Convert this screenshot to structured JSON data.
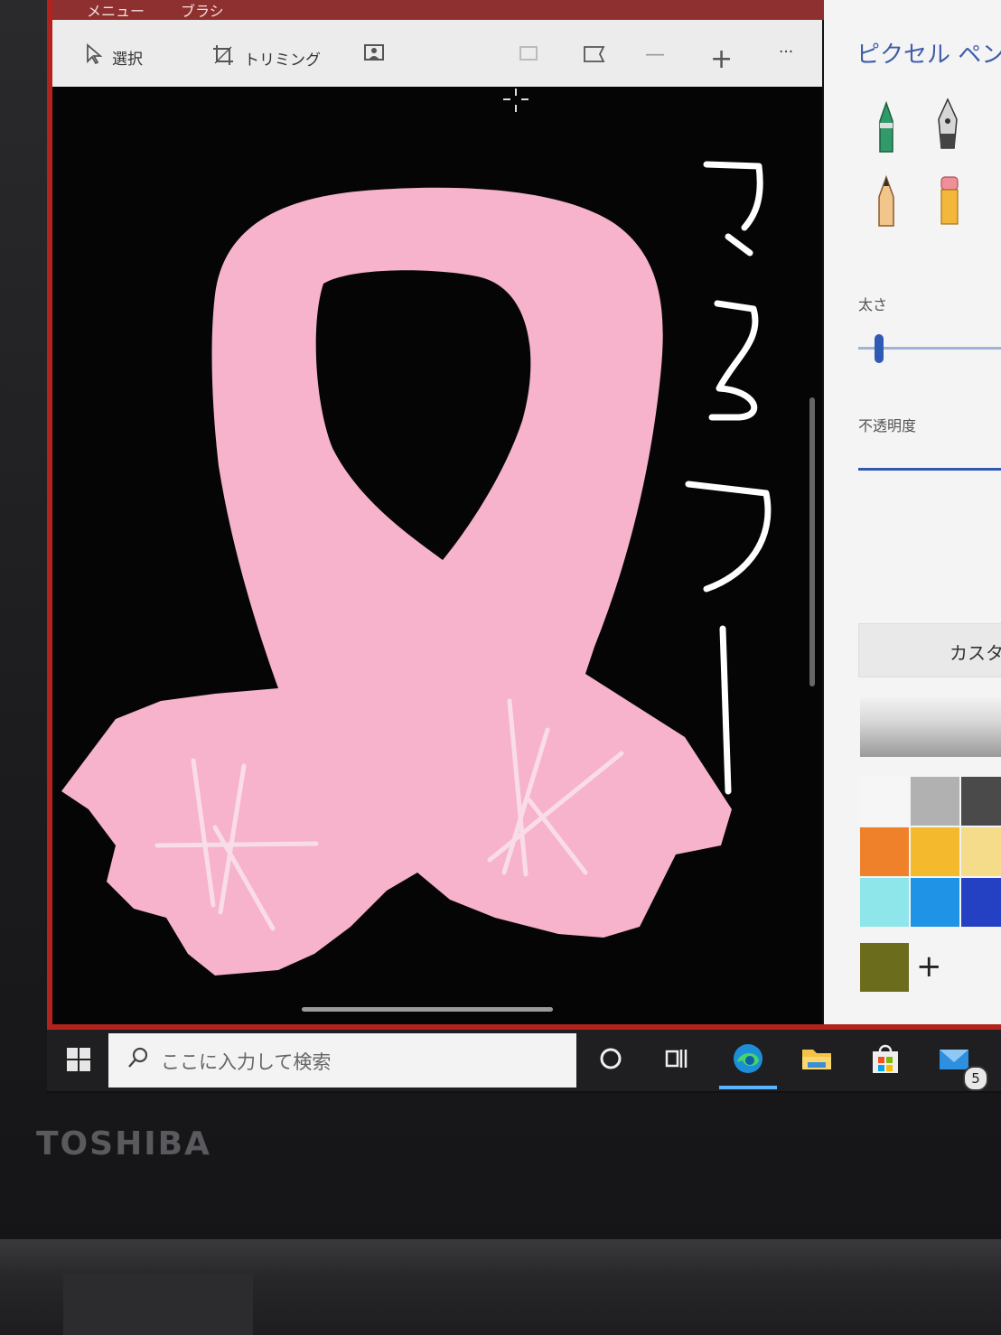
{
  "window": {
    "menu_items": [
      "メニュー",
      "ブラシ"
    ]
  },
  "toolbar": {
    "select_label": "選択",
    "trim_label": "トリミング",
    "more_label": "···"
  },
  "canvas": {
    "handwritten_text": [
      "マ",
      "フ",
      "ラ",
      "ー"
    ]
  },
  "panel": {
    "title": "ピクセル ペン",
    "thickness_label": "太さ",
    "thickness_value": 0.12,
    "opacity_label": "不透明度",
    "opacity_value": 1.0,
    "custom_button_label": "カスタ",
    "add_color_label": "+",
    "swatches": [
      [
        "#f6f6f6",
        "#b1b1b1",
        "#4a4a4a"
      ],
      [
        "#f0812b",
        "#f5b92e",
        "#f4dc8a"
      ],
      [
        "#8fe6ea",
        "#1f93e6",
        "#2441c4"
      ]
    ],
    "selected_color": "#6b6d1d"
  },
  "taskbar": {
    "search_placeholder": "ここに入力して検索",
    "mail_badge": "5"
  },
  "device": {
    "brand": "TOSHIBA"
  },
  "colors": {
    "accent": "#3f5da8",
    "frame_red": "#b3231d",
    "ribbon_pink": "#f6b3cb"
  }
}
